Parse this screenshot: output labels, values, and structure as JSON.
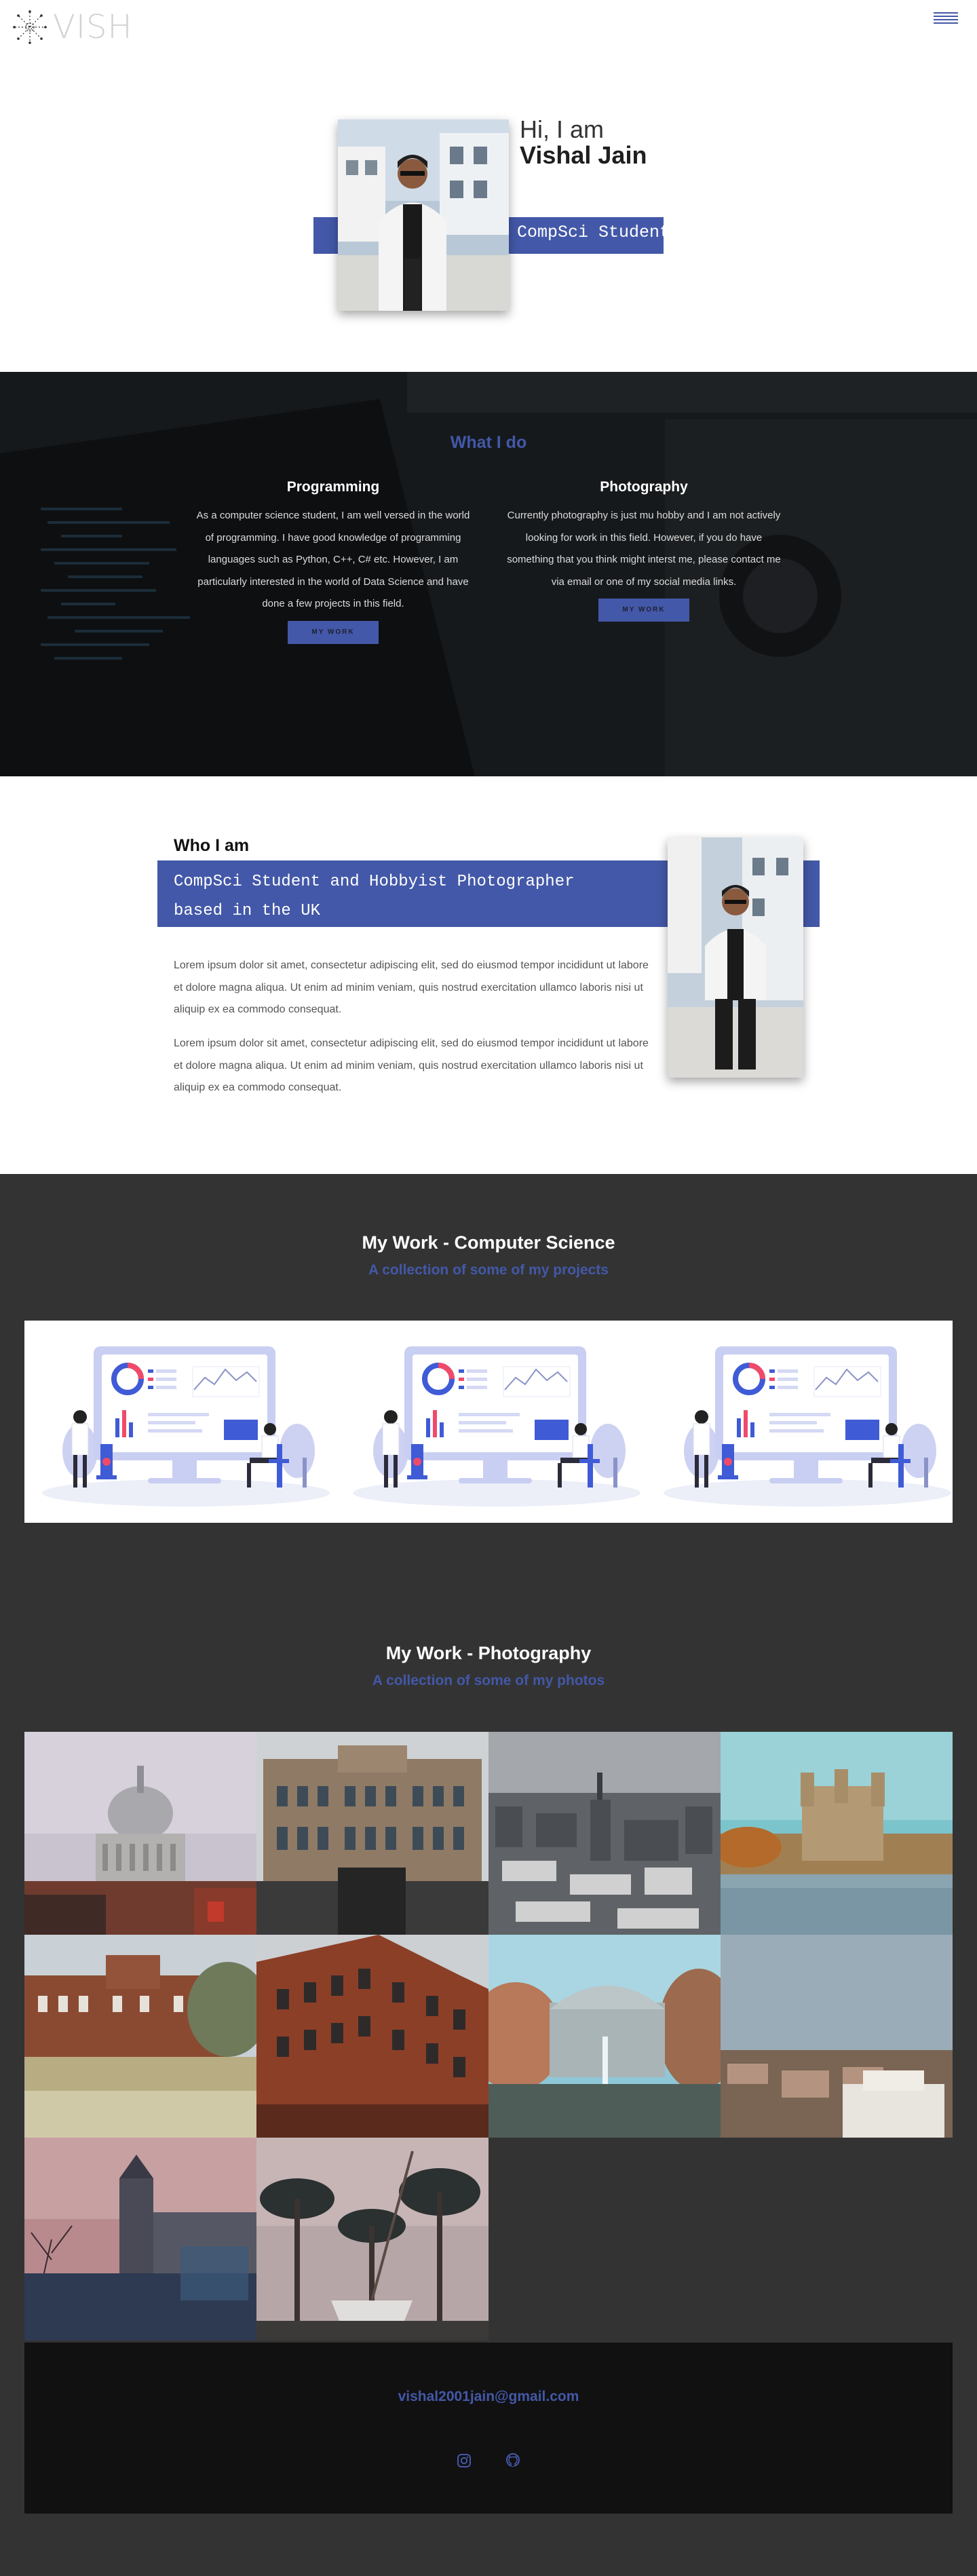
{
  "header": {
    "logo_text": "VISH",
    "logo_icon": "starburst-logo-icon",
    "menu_icon": "hamburger-menu-icon"
  },
  "hero": {
    "greeting": "Hi, I am",
    "name": "Vishal Jain",
    "role": "CompSci Student"
  },
  "what_i_do": {
    "title": "What I do",
    "programming": {
      "heading": "Programming",
      "text": "As a computer science student, I am well versed in the world of programming. I have good knowledge of programming languages such as Python, C++, C# etc. However, I am particularly interested in the world of Data Science and have done a few projects in this field.",
      "button": "MY WORK"
    },
    "photography": {
      "heading": "Photography",
      "text": "Currently photography is just mu hobby and I am not actively looking for work in this field. However, if you do have something that you think might interst me, please contact me via email or one of my social media links.",
      "button": "MY WORK"
    }
  },
  "who_i_am": {
    "title": "Who I am",
    "tagline_line1": "CompSci Student and Hobbyist Photographer",
    "tagline_line2": "based in the UK",
    "paragraph1": "Lorem ipsum dolor sit amet, consectetur adipiscing elit, sed do eiusmod tempor incididunt ut labore et dolore magna aliqua. Ut enim ad minim veniam, quis nostrud exercitation ullamco laboris nisi ut aliquip ex ea commodo consequat.",
    "paragraph2": "Lorem ipsum dolor sit amet, consectetur adipiscing elit, sed do eiusmod tempor incididunt ut labore et dolore magna aliqua. Ut enim ad minim veniam, quis nostrud exercitation ullamco laboris nisi ut aliquip ex ea commodo consequat."
  },
  "work_cs": {
    "title": "My Work - Computer Science",
    "subtitle": "A collection of some of my projects"
  },
  "work_photo": {
    "title": "My Work - Photography",
    "subtitle": "A collection of some of my photos"
  },
  "footer": {
    "email": "vishal2001jain@gmail.com",
    "icons": [
      "instagram-icon",
      "github-icon"
    ]
  },
  "colors": {
    "accent": "#4358a8",
    "dark_section": "#333333",
    "footer": "#111111"
  }
}
